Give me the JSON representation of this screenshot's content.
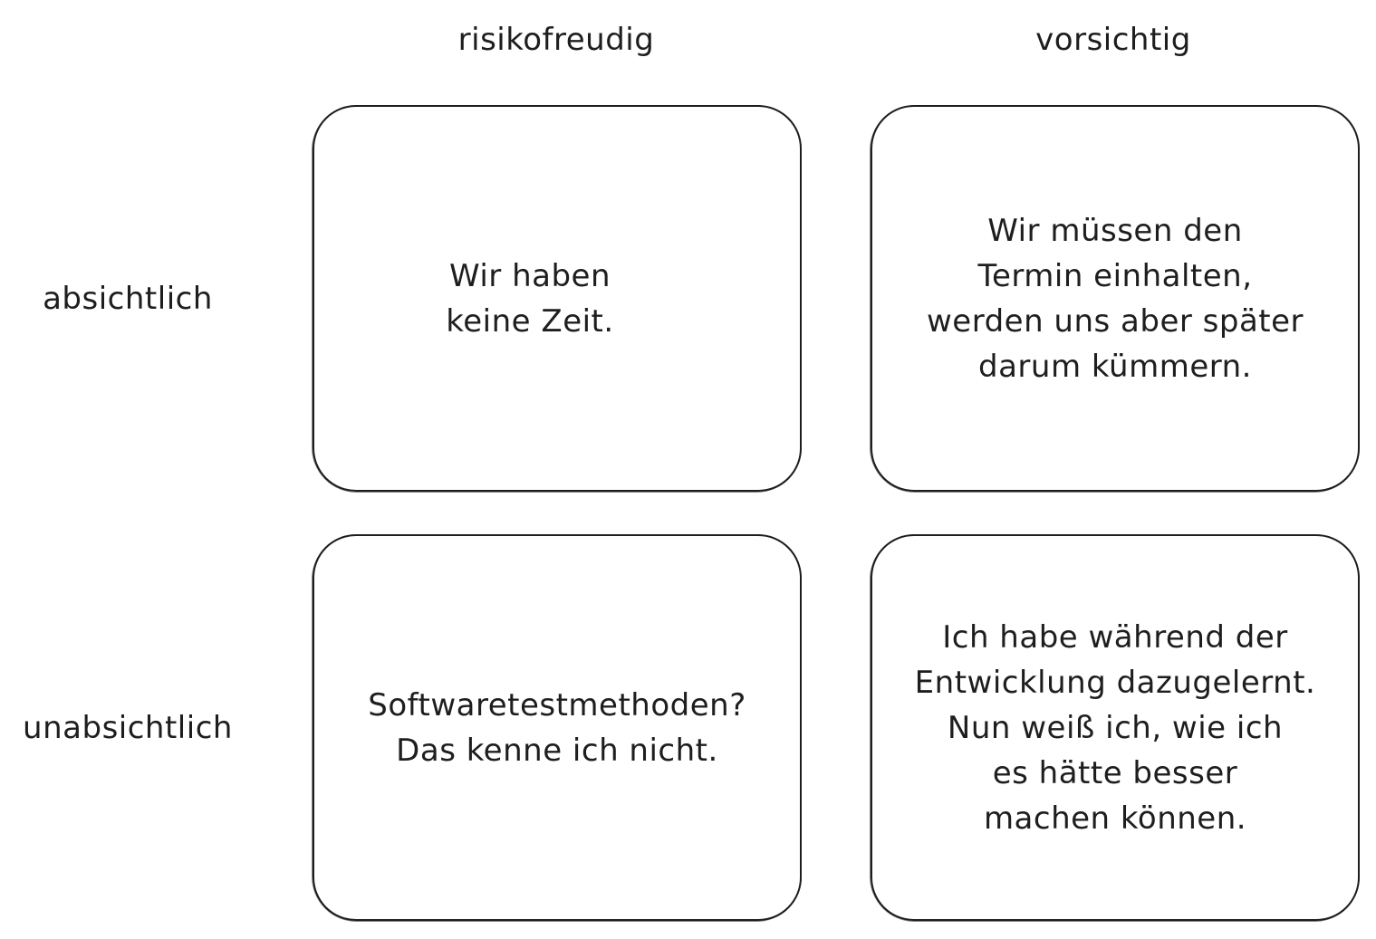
{
  "columns": [
    "risikofreudig",
    "vorsichtig"
  ],
  "rows": [
    "absichtlich",
    "unabsichtlich"
  ],
  "quadrants": [
    {
      "lines": [
        "Wir haben",
        "keine Zeit."
      ]
    },
    {
      "lines": [
        "Wir müssen den",
        "Termin einhalten,",
        "werden uns aber später",
        "darum kümmern."
      ]
    },
    {
      "lines": [
        "Softwaretestmethoden?",
        "Das kenne ich nicht."
      ]
    },
    {
      "lines": [
        "Ich habe während der",
        "Entwicklung dazugelernt.",
        "Nun weiß ich, wie ich",
        "es hätte besser",
        "machen können."
      ]
    }
  ]
}
